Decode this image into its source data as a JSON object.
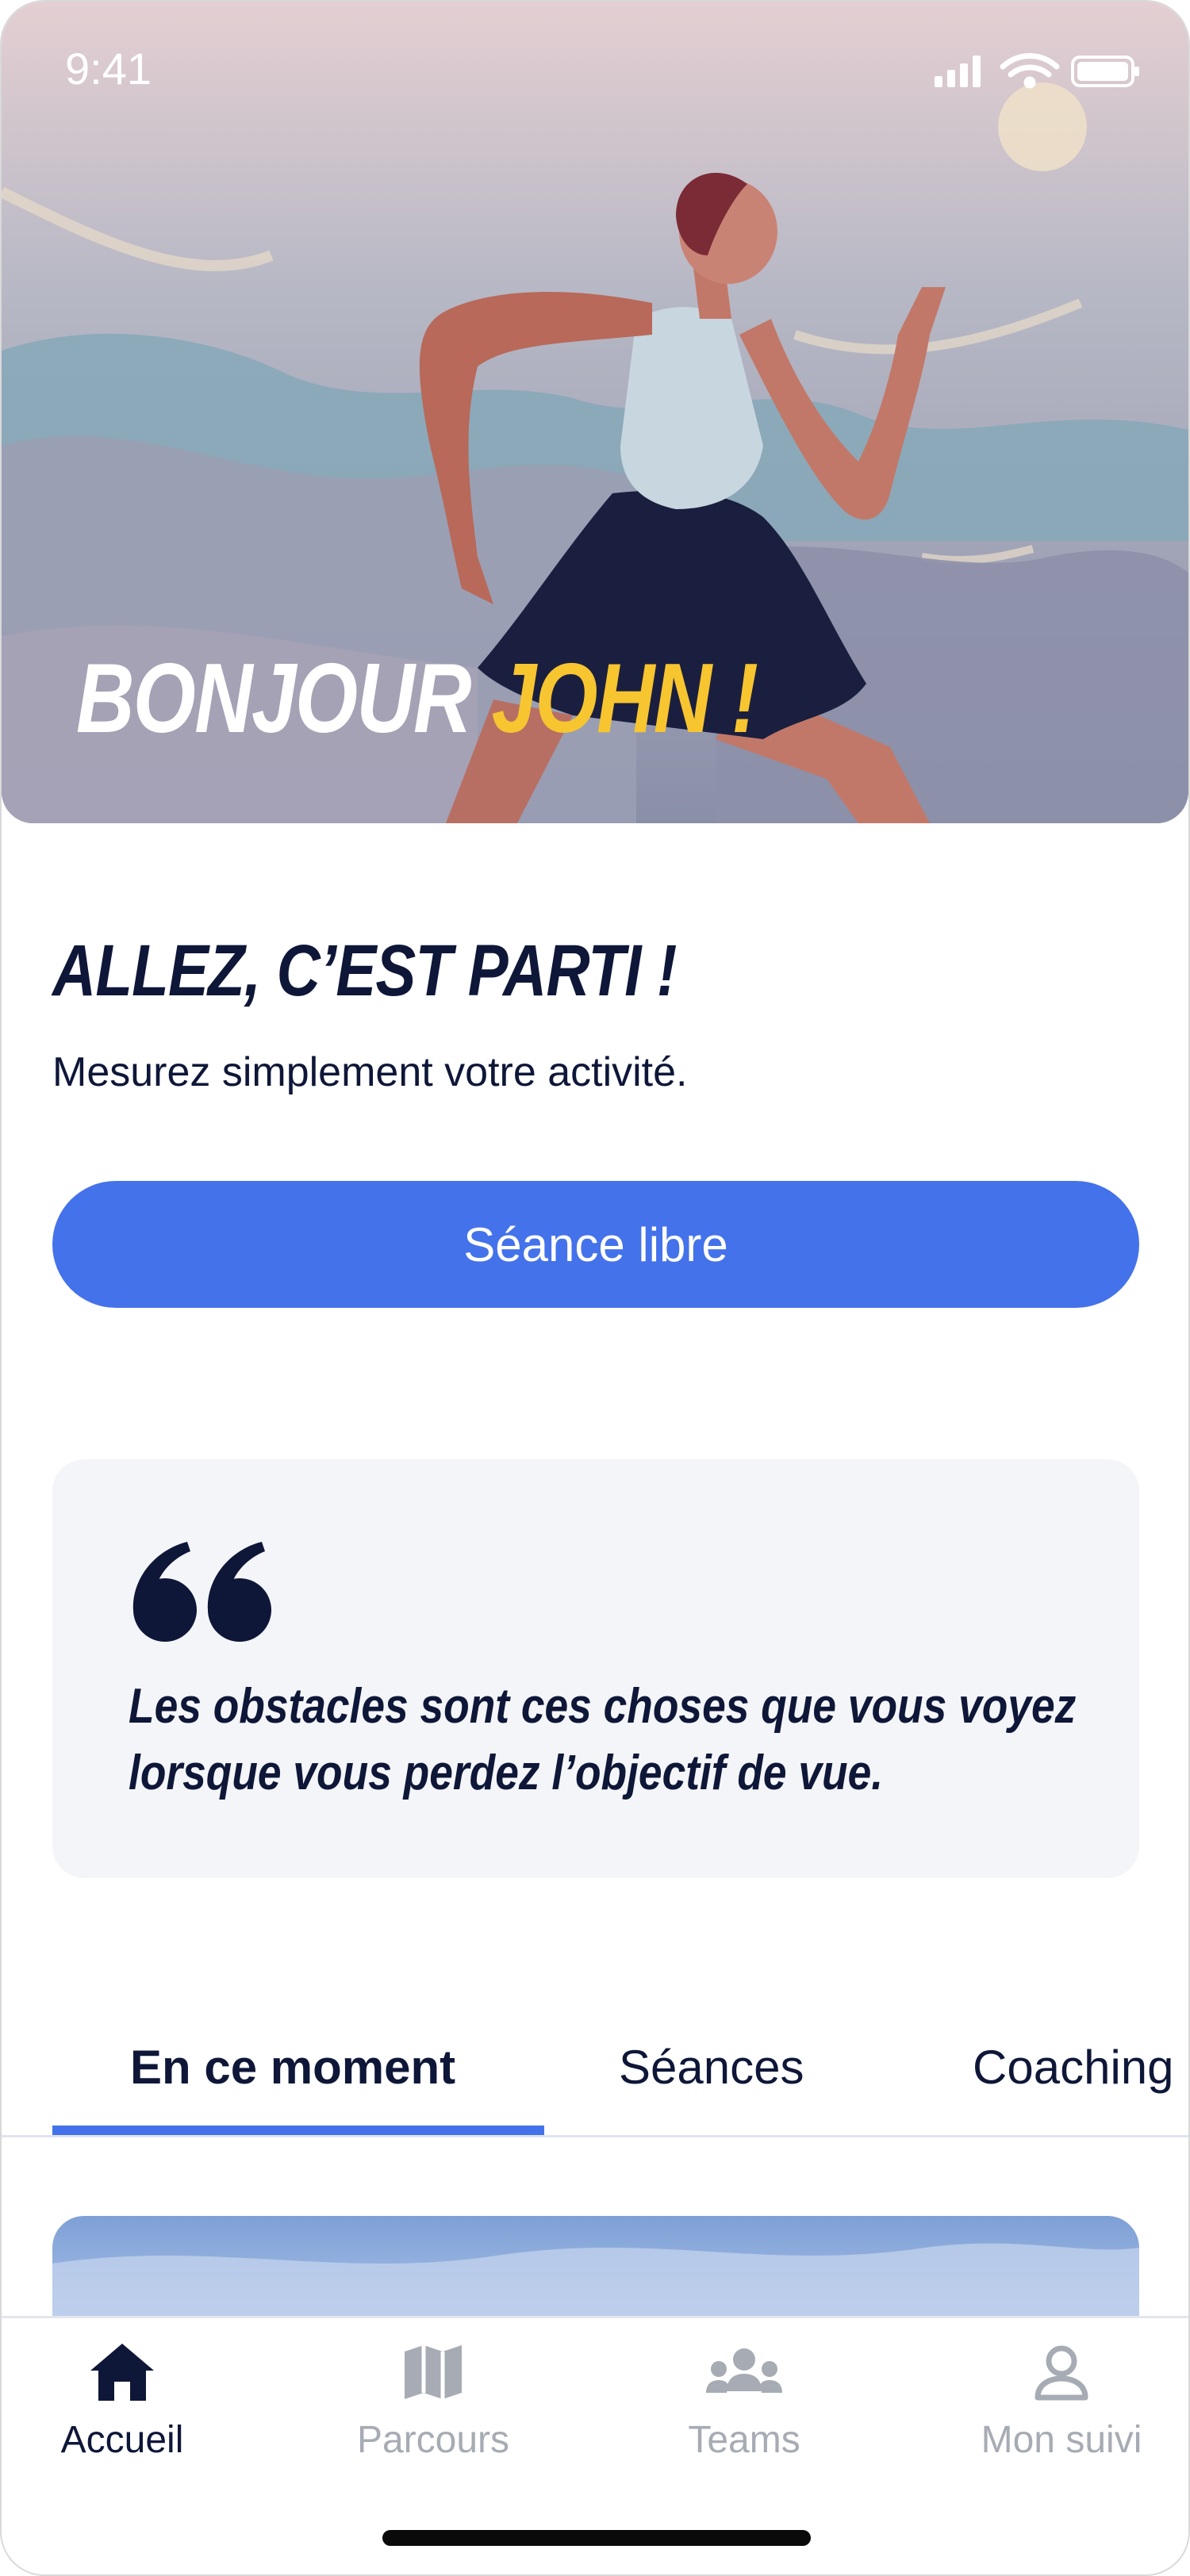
{
  "status_bar": {
    "time": "9:41"
  },
  "hero": {
    "greeting_prefix": "BONJOUR ",
    "greeting_name": "JOHN !"
  },
  "intro": {
    "headline": "ALLEZ, C’EST PARTI !",
    "subline": "Mesurez simplement votre activité.",
    "cta_label": "Séance libre"
  },
  "quote": {
    "text": "Les obstacles sont ces choses que vous voyez lorsque vous perdez l’objectif de vue."
  },
  "tabs": [
    {
      "label": "En ce moment",
      "active": true
    },
    {
      "label": "Séances",
      "active": false
    },
    {
      "label": "Coaching",
      "active": false
    }
  ],
  "bottom_nav": [
    {
      "label": "Accueil",
      "icon": "home-icon",
      "active": true
    },
    {
      "label": "Parcours",
      "icon": "map-icon",
      "active": false
    },
    {
      "label": "Teams",
      "icon": "teams-icon",
      "active": false
    },
    {
      "label": "Mon suivi",
      "icon": "profile-icon",
      "active": false
    }
  ],
  "colors": {
    "accent": "#4472ea",
    "navy": "#0e1738",
    "highlight_yellow": "#f7c52f",
    "inactive_gray": "#a6abb4"
  }
}
